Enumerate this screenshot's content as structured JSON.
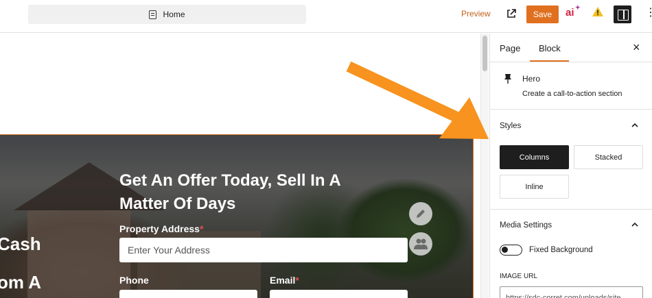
{
  "header": {
    "document_title": "Home",
    "preview_label": "Preview",
    "save_label": "Save",
    "ai_label": "ai",
    "icons": [
      "document-icon",
      "external-link-icon",
      "ai-sparkle-icon",
      "warning-icon",
      "sidebar-toggle-icon",
      "more-options-icon"
    ]
  },
  "hero": {
    "title": "Get An Offer Today, Sell In A Matter Of Days",
    "left_text_1": "Cash",
    "left_text_2": "om A",
    "property_address_label": "Property Address",
    "required_mark": "*",
    "address_placeholder": "Enter Your Address",
    "phone_label": "Phone",
    "email_label": "Email"
  },
  "sidebar": {
    "tabs": [
      {
        "label": "Page",
        "active": false
      },
      {
        "label": "Block",
        "active": true
      }
    ],
    "close_label": "×",
    "block": {
      "name": "Hero",
      "description": "Create a call-to-action section"
    },
    "styles": {
      "heading": "Styles",
      "options": [
        {
          "label": "Columns",
          "active": true
        },
        {
          "label": "Stacked",
          "active": false
        },
        {
          "label": "Inline",
          "active": false
        }
      ]
    },
    "media_settings": {
      "heading": "Media Settings",
      "fixed_background_label": "Fixed Background",
      "fixed_background_on": false,
      "image_url_label": "IMAGE URL",
      "image_url_value": "https://sdc-corret.com/uploads/site"
    }
  },
  "colors": {
    "accent": "#e07020",
    "annotation_arrow": "#f7931e",
    "dark": "#1e1e1e"
  }
}
